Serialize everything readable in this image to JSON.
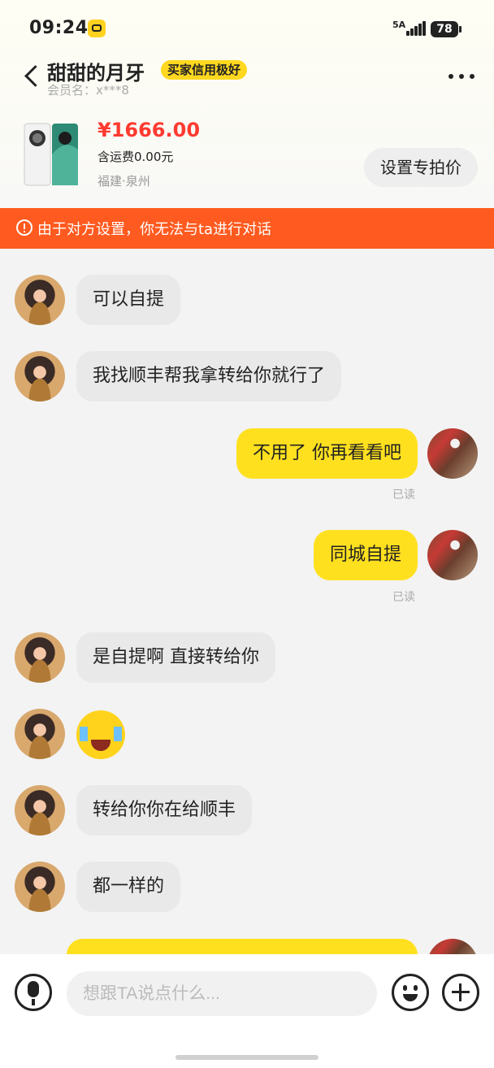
{
  "status_bar": {
    "time": "09:24",
    "network": "5A",
    "battery": "78"
  },
  "header": {
    "name": "甜甜的月牙",
    "badge": "买家信用极好",
    "member": "会员名：x***8"
  },
  "product": {
    "price": "¥1666.00",
    "shipping": "含运费0.00元",
    "location": "福建·泉州",
    "set_price_button": "设置专拍价"
  },
  "notice": "由于对方设置，你无法与ta进行对话",
  "messages": [
    {
      "side": "left",
      "text": "可以自提"
    },
    {
      "side": "left",
      "text": "我找顺丰帮我拿转给你就行了"
    },
    {
      "side": "right",
      "text": "不用了 你再看看吧",
      "status": "已读"
    },
    {
      "side": "right",
      "text": "同城自提",
      "status": "已读"
    },
    {
      "side": "left",
      "text": "是自提啊 直接转给你"
    },
    {
      "side": "left",
      "type": "emoji",
      "icon": "crying-laughing-emoji"
    },
    {
      "side": "left",
      "text": "转给你你在给顺丰"
    },
    {
      "side": "left",
      "text": "都一样的"
    }
  ],
  "input": {
    "placeholder": "想跟TA说点什么..."
  },
  "colors": {
    "accent": "#ffe01f",
    "notice": "#ff5a1f",
    "price": "#ff3a30"
  }
}
